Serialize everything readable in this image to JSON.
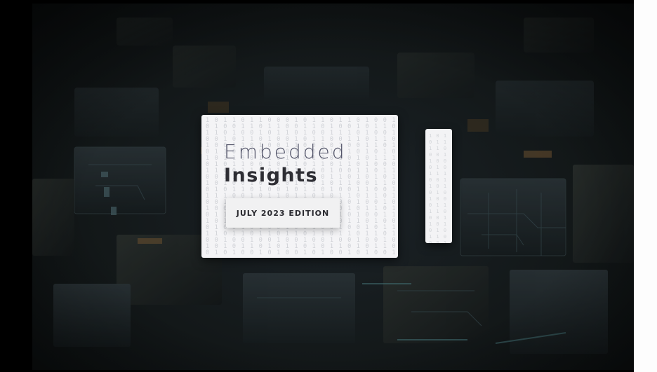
{
  "slide": {
    "title_line1": "Embedded",
    "title_line2": "Insights",
    "edition": "JULY 2023 EDITION"
  },
  "colors": {
    "background_dark": "#131819",
    "card_background": "#f4f4f6",
    "title_light": "#4f5166",
    "title_bold": "#2e2e34"
  },
  "decoration": {
    "binary_rows": [
      "1 0 1 1 0 1 1 0 0 0 1 0 1 1 0 1 1 0 1 0 0 1",
      "0 1 0 0 1 1 0 1 1 0 0 1 1 0 1 0 0 1 0 1 1 0",
      "1 1 0 1 0 0 1 0 1 1 0 1 0 0 1 1 1 0 1 0 0 1",
      "0 0 1 0 1 1 0 1 0 0 1 0 1 1 0 0 1 1 0 1 1 0",
      "1 0 0 1 1 0 1 0 0 1 1 0 0 1 0 1 0 0 1 1 0 1",
      "0 1 1 0 0 1 0 1 1 0 1 1 0 1 1 0 1 0 1 0 1 0",
      "1 0 1 1 0 0 1 1 0 1 0 0 1 0 0 1 0 1 0 1 1 1",
      "0 1 0 1 1 0 0 1 0 1 1 0 1 1 0 1 1 0 1 0 0 0",
      "1 1 0 0 1 1 0 0 1 0 1 1 0 0 1 0 0 1 1 0 1 1",
      "0 0 1 1 0 1 1 0 1 0 0 1 1 0 1 1 0 1 0 1 0 1",
      "1 0 1 0 0 1 0 1 1 0 1 0 0 1 0 1 1 0 0 1 1 0",
      "0 1 0 1 1 0 1 0 0 1 0 1 1 0 1 0 0 1 1 0 0 1",
      "1 1 1 0 0 1 0 1 1 0 1 1 0 1 0 1 1 0 1 1 0 1",
      "0 0 1 1 1 0 1 0 0 1 0 0 1 0 1 0 0 1 0 0 1 0",
      "1 0 0 1 0 1 1 0 1 1 0 1 0 1 1 0 1 0 1 1 0 1",
      "0 1 1 0 1 0 0 1 0 0 1 0 1 0 0 1 0 1 0 0 1 1",
      "1 0 1 1 0 1 0 1 1 0 1 1 0 1 1 0 1 1 0 1 0 0",
      "0 1 0 0 1 0 1 0 0 1 0 0 1 0 0 1 0 0 1 0 1 1",
      "1 1 0 1 1 0 1 1 0 1 1 0 1 1 0 1 1 0 1 1 0 1",
      "0 0 1 0 0 1 0 0 1 0 0 1 0 0 1 0 0 1 0 0 1 0",
      "1 0 1 0 1 1 0 1 0 1 1 0 1 0 1 1 0 1 0 1 1 0",
      "0 1 0 1 0 0 1 0 1 0 0 1 0 1 0 0 1 0 1 0 0 1"
    ],
    "side_rows": [
      "1 0 1",
      "0 1 1",
      "1 1 0",
      "0 0 1",
      "1 0 0",
      "0 1 0",
      "1 1 1",
      "0 0 1",
      "1 0 1",
      "0 1 0",
      "1 0 0",
      "0 1 1",
      "1 1 0",
      "0 0 1",
      "1 0 1",
      "0 1 0",
      "1 1 0",
      "0 0 1"
    ]
  }
}
